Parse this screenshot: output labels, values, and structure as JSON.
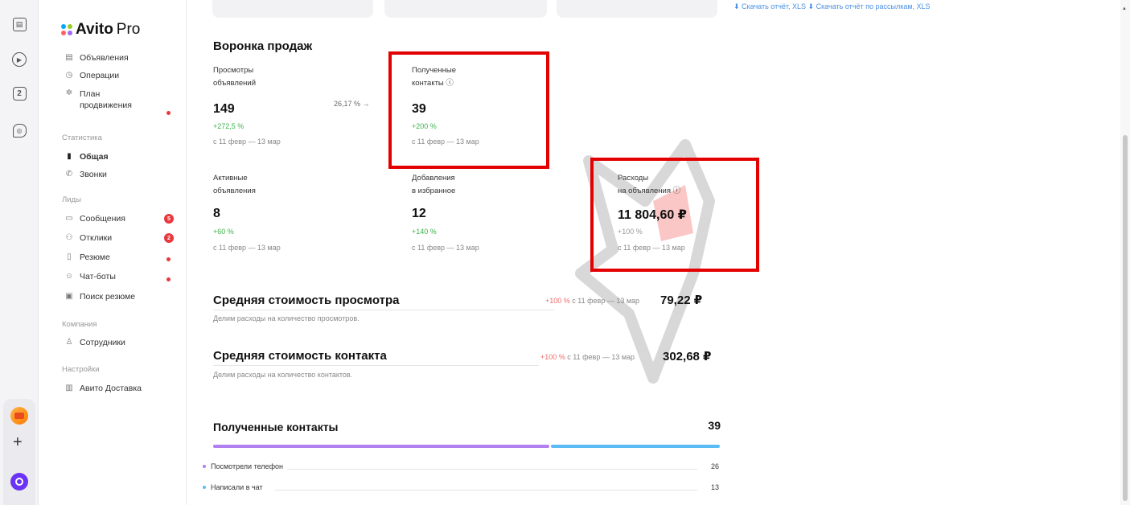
{
  "brand": {
    "name": "Avito",
    "suffix": " Pro"
  },
  "colors": {
    "accent_red": "#e8383d",
    "link_blue": "#4a90e2",
    "green": "#3cb44b",
    "highlight_box": "#e30000",
    "bar_purple": "#b07ff0",
    "bar_blue": "#5bbcf5"
  },
  "rail": {
    "icons": [
      "docs-icon",
      "play-circle-icon",
      "two-square-icon",
      "chat-bubble-icon"
    ],
    "badge2": "2",
    "add": "+"
  },
  "sidebar": {
    "items": [
      {
        "label": "Объявления",
        "icon": "list-icon"
      },
      {
        "label": "Операции",
        "icon": "clock-icon"
      },
      {
        "label": "План",
        "label2": "продвижения",
        "icon": "lightbulb-icon"
      }
    ],
    "section_stats": "Статистика",
    "stats_items": [
      {
        "label": "Общая",
        "icon": "bar-chart-icon"
      },
      {
        "label": "Звонки",
        "icon": "phone-icon"
      }
    ],
    "section_leads": "Лиды",
    "leads_items": [
      {
        "label": "Сообщения",
        "icon": "message-icon",
        "badge": "5"
      },
      {
        "label": "Отклики",
        "icon": "people-icon",
        "badge": "2"
      },
      {
        "label": "Резюме",
        "icon": "doc-icon"
      },
      {
        "label": "Чат-боты",
        "icon": "bot-icon"
      },
      {
        "label": "Поиск резюме",
        "icon": "search-doc-icon"
      }
    ],
    "section_company": "Компания",
    "company_items": [
      {
        "label": "Сотрудники",
        "icon": "person-icon"
      }
    ],
    "section_settings": "Настройки",
    "settings_items": [
      {
        "label": "Авито Доставка",
        "icon": "delivery-icon"
      }
    ]
  },
  "funnel": {
    "title": "Воронка продаж",
    "views": {
      "label1": "Просмотры",
      "label2": "объявлений",
      "value": "149",
      "change": "+272,5 %",
      "period": "с 11 февр — 13 мар"
    },
    "conversion": "26,17 % →",
    "contacts": {
      "label1": "Полученные",
      "label2": "контакты ⓘ",
      "value": "39",
      "change": "+200 %",
      "period": "с 11 февр — 13 мар"
    },
    "active": {
      "label1": "Активные",
      "label2": "объявления",
      "value": "8",
      "change": "+60 %",
      "period": "с 11 февр — 13 мар"
    },
    "favorites": {
      "label1": "Добавления",
      "label2": "в избранное",
      "value": "12",
      "change": "+140 %",
      "period": "с 11 февр — 13 мар"
    },
    "spend": {
      "label1": "Расходы",
      "label2": "на объявления ⓘ",
      "value": "11 804,60 ₽",
      "change": "+100 %",
      "period": "с 11 февр — 13 мар"
    }
  },
  "avg_view": {
    "title": "Средняя стоимость просмотра",
    "desc": "Делим расходы на количество просмотров.",
    "change": "+100 %",
    "period": " с 11 февр — 13 мар",
    "value": "79,22 ₽"
  },
  "avg_contact": {
    "title": "Средняя стоимость контакта",
    "desc": "Делим расходы на количество контактов.",
    "change": "+100 %",
    "period": " с 11 февр — 13 мар",
    "value": "302,68 ₽"
  },
  "contacts_block": {
    "title": "Полученные контакты",
    "total": "39",
    "split": [
      0.667,
      0.333
    ],
    "rows": [
      {
        "label": "Посмотрели телефон",
        "value": "26",
        "color": "#b07ff0"
      },
      {
        "label": "Написали в чат",
        "value": "13",
        "color": "#5bbcf5"
      }
    ]
  },
  "top": {
    "links": "⬇ Скачать отчёт, XLS   ⬇ Скачать отчёт по рассылкам, XLS"
  }
}
